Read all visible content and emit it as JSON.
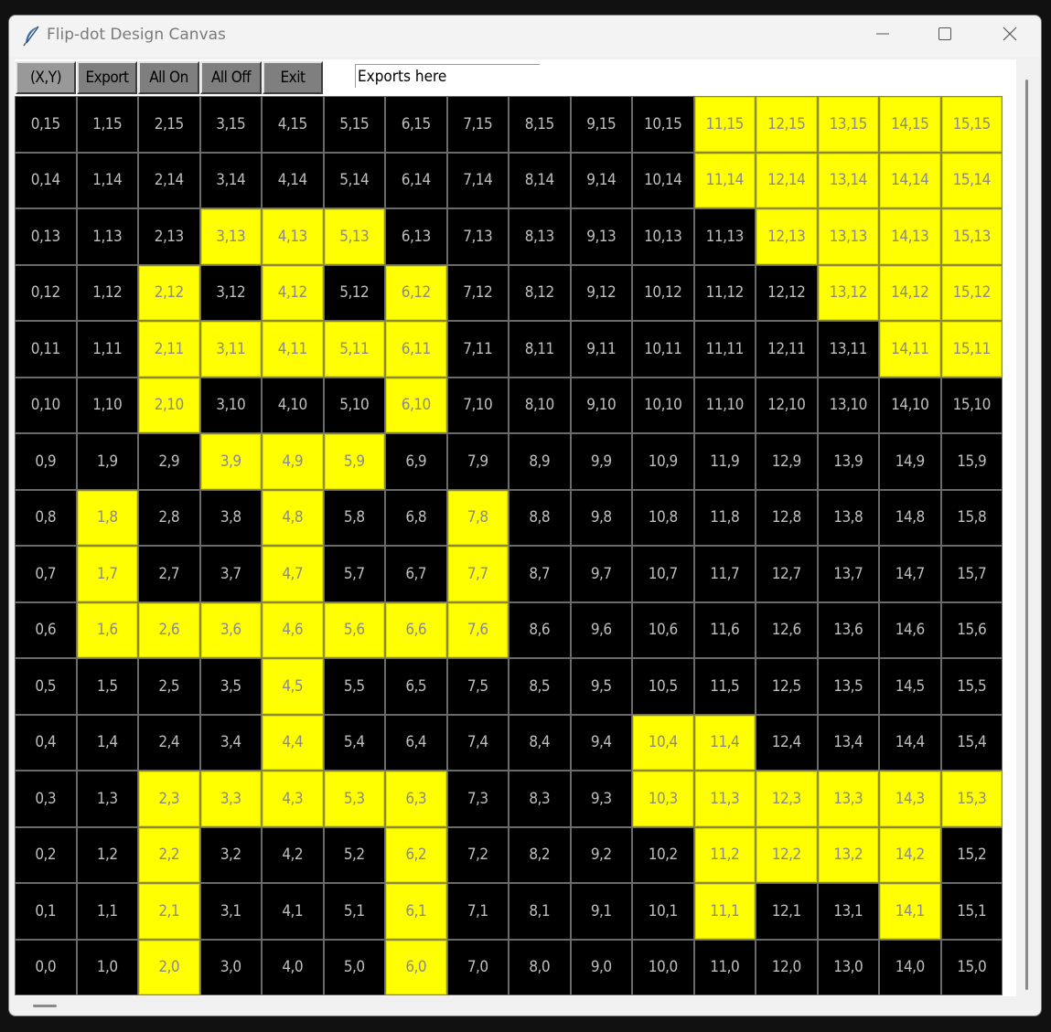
{
  "window": {
    "title": "Flip-dot Design Canvas",
    "controls": {
      "minimize_icon": "minimize-icon",
      "maximize_icon": "maximize-icon",
      "close_icon": "close-icon"
    }
  },
  "toolbar": {
    "buttons": [
      {
        "label": "(X,Y)",
        "name": "xy-button"
      },
      {
        "label": "Export",
        "name": "export-button"
      },
      {
        "label": "All On",
        "name": "all-on-button"
      },
      {
        "label": "All Off",
        "name": "all-off-button"
      },
      {
        "label": "Exit",
        "name": "exit-button"
      }
    ],
    "export_field_value": "Exports here"
  },
  "colors": {
    "on": "#ffff00",
    "off": "#000000",
    "button": "#7f7f7f"
  },
  "grid": {
    "columns": 16,
    "rows": 16,
    "on_cells": [
      "11,15",
      "12,15",
      "13,15",
      "14,15",
      "15,15",
      "11,14",
      "12,14",
      "13,14",
      "14,14",
      "15,14",
      "3,13",
      "4,13",
      "5,13",
      "12,13",
      "13,13",
      "14,13",
      "15,13",
      "2,12",
      "4,12",
      "6,12",
      "13,12",
      "14,12",
      "15,12",
      "2,11",
      "3,11",
      "4,11",
      "5,11",
      "6,11",
      "14,11",
      "15,11",
      "2,10",
      "6,10",
      "3,9",
      "4,9",
      "5,9",
      "1,8",
      "4,8",
      "7,8",
      "1,7",
      "4,7",
      "7,7",
      "1,6",
      "2,6",
      "3,6",
      "4,6",
      "5,6",
      "6,6",
      "7,6",
      "4,5",
      "4,4",
      "10,4",
      "11,4",
      "2,3",
      "3,3",
      "4,3",
      "5,3",
      "6,3",
      "10,3",
      "11,3",
      "12,3",
      "13,3",
      "14,3",
      "15,3",
      "2,2",
      "6,2",
      "11,2",
      "12,2",
      "13,2",
      "14,2",
      "2,1",
      "6,1",
      "11,1",
      "14,1",
      "2,0",
      "6,0"
    ]
  }
}
